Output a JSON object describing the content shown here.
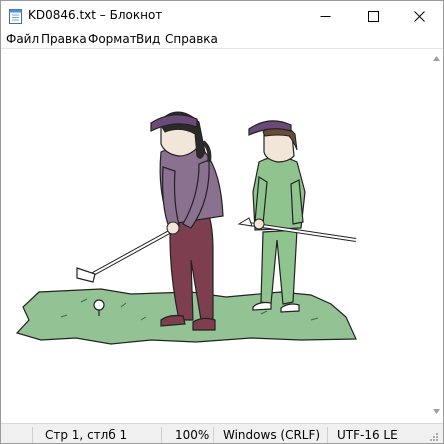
{
  "window": {
    "title": "KD0846.txt – Блокнот",
    "icon": "notepad-icon",
    "controls": [
      "minimize-icon",
      "maximize-icon",
      "close-icon"
    ]
  },
  "menu": {
    "items": [
      "Файл",
      "Правка",
      "Формат",
      "Вид",
      "Справка"
    ]
  },
  "status": {
    "position": "Стр 1, стлб 1",
    "zoom": "100%",
    "line_endings": "Windows (CRLF)",
    "encoding": "UTF-16 LE"
  },
  "colors": {
    "grass": "#93c394",
    "shirt_left": "#8a7190",
    "pants_left": "#7d3f4f",
    "outfit_right": "#8fc48e",
    "visor": "#6b4a7a",
    "skin": "#f1e6d8",
    "hair": "#2a2a2a"
  }
}
